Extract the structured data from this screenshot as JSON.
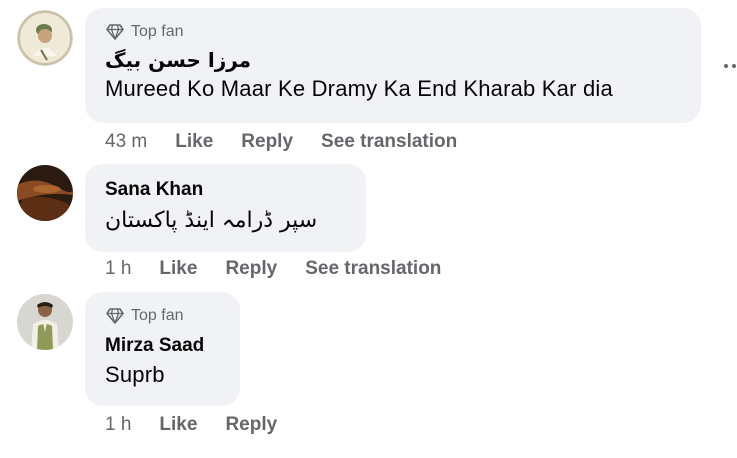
{
  "comments": [
    {
      "badge": "Top fan",
      "author": "مرزا حسن بیگ",
      "text": "Mureed Ko Maar Ke Dramy Ka End Kharab Kar dia",
      "time": "43 m",
      "like": "Like",
      "reply": "Reply",
      "translate": "See translation"
    },
    {
      "author": "Sana Khan",
      "text": "سپر ڈرامہ اینڈ پاکستان",
      "time": "1 h",
      "like": "Like",
      "reply": "Reply",
      "translate": "See translation"
    },
    {
      "badge": "Top fan",
      "author": "Mirza Saad",
      "text": "Suprb",
      "time": "1 h",
      "like": "Like",
      "reply": "Reply"
    }
  ],
  "colors": {
    "bubble": "#f0f2f5",
    "secondary_text": "#65676b",
    "primary_text": "#050505"
  },
  "icons": {
    "badge": "diamond-icon",
    "more": "more-options-icon"
  }
}
